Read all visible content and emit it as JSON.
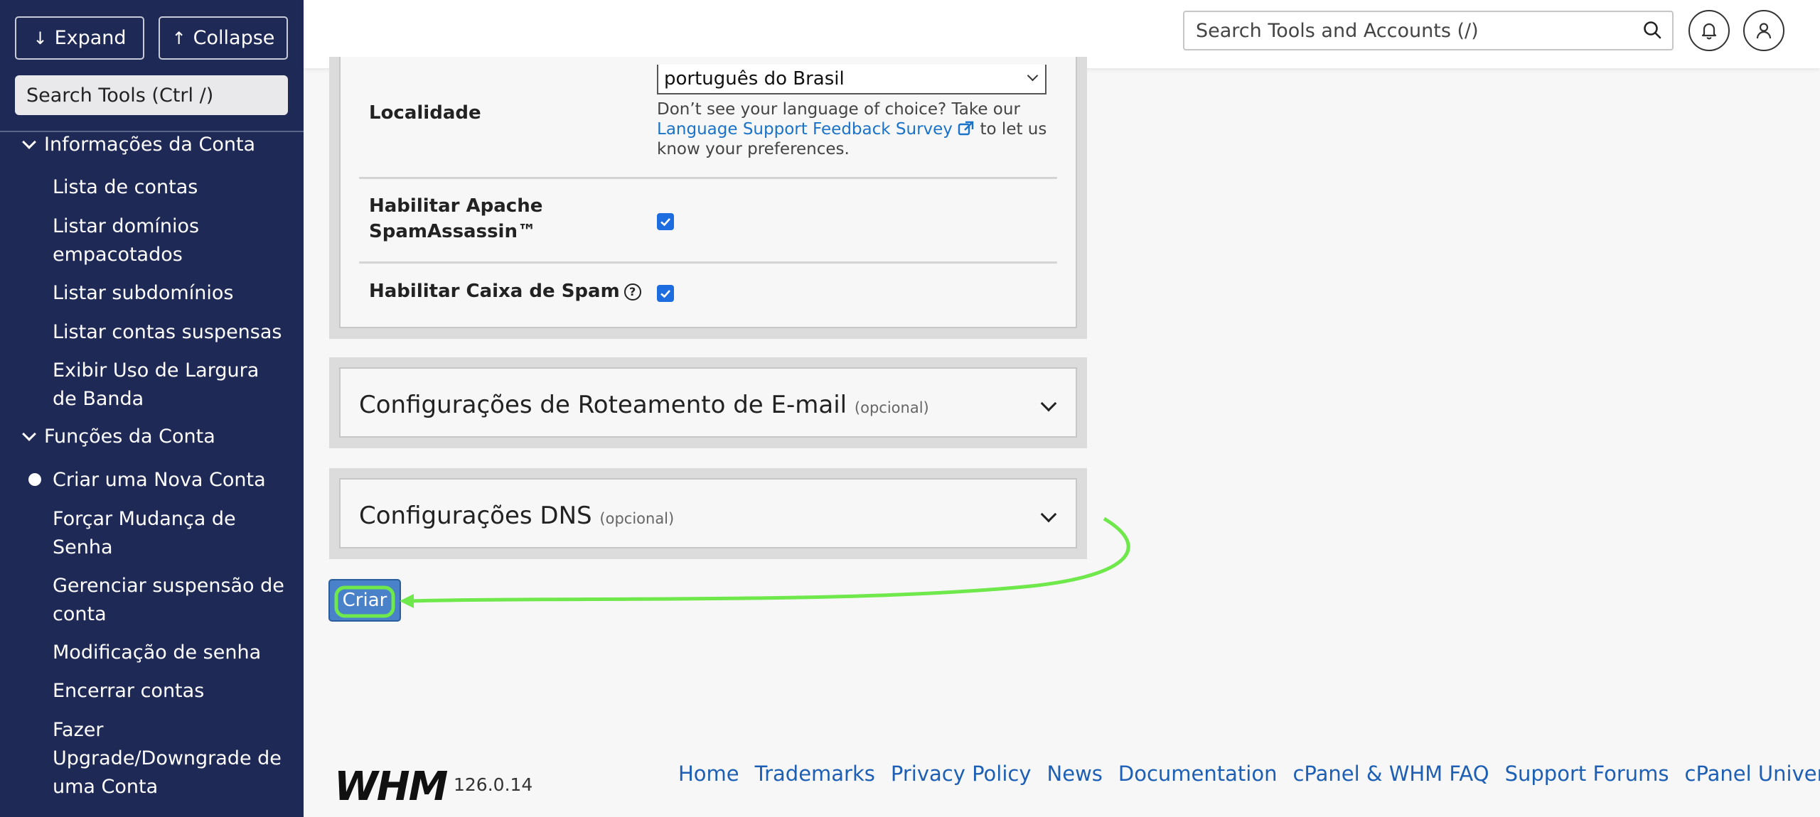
{
  "sidebar": {
    "expand_label": "Expand",
    "collapse_label": "Collapse",
    "search_placeholder": "Search Tools (Ctrl /)",
    "sections": [
      {
        "title": "Informações da Conta",
        "items": [
          "Lista de contas",
          "Listar domínios empacotados",
          "Listar subdomínios",
          "Listar contas suspensas",
          "Exibir Uso de Largura de Banda"
        ]
      },
      {
        "title": "Funções da Conta",
        "items": [
          "Criar uma Nova Conta",
          "Forçar Mudança de Senha",
          "Gerenciar suspensão de conta",
          "Modificação de senha",
          "Encerrar contas",
          "Fazer Upgrade/Downgrade de uma Conta"
        ]
      }
    ],
    "active_item": "Criar uma Nova Conta"
  },
  "header": {
    "search_placeholder": "Search Tools and Accounts (/)"
  },
  "settings": {
    "locale_label": "Localidade",
    "locale_value": "português do Brasil",
    "locale_help_prefix": "Don’t see your language of choice? Take our",
    "locale_help_link": "Language Support Feedback Survey",
    "locale_help_suffix": "to let us know your preferences.",
    "spamassassin_label": "Habilitar Apache SpamAssassin™",
    "spamassassin_checked": true,
    "spam_box_label": "Habilitar Caixa de Spam",
    "spam_box_checked": true
  },
  "collapsibles": [
    {
      "title": "Configurações de Roteamento de E-mail",
      "optional": "(opcional)"
    },
    {
      "title": "Configurações DNS",
      "optional": "(opcional)"
    }
  ],
  "create_button_label": "Criar",
  "footer": {
    "logo": "WHM",
    "version": "126.0.14",
    "links": [
      "Home",
      "Trademarks",
      "Privacy Policy",
      "News",
      "Documentation",
      "cPanel & WHM FAQ",
      "Support Forums",
      "cPanel University"
    ]
  },
  "colors": {
    "sidebar_bg": "#1f2955",
    "accent": "#1d6ce0",
    "annotation": "#6ee84a"
  }
}
